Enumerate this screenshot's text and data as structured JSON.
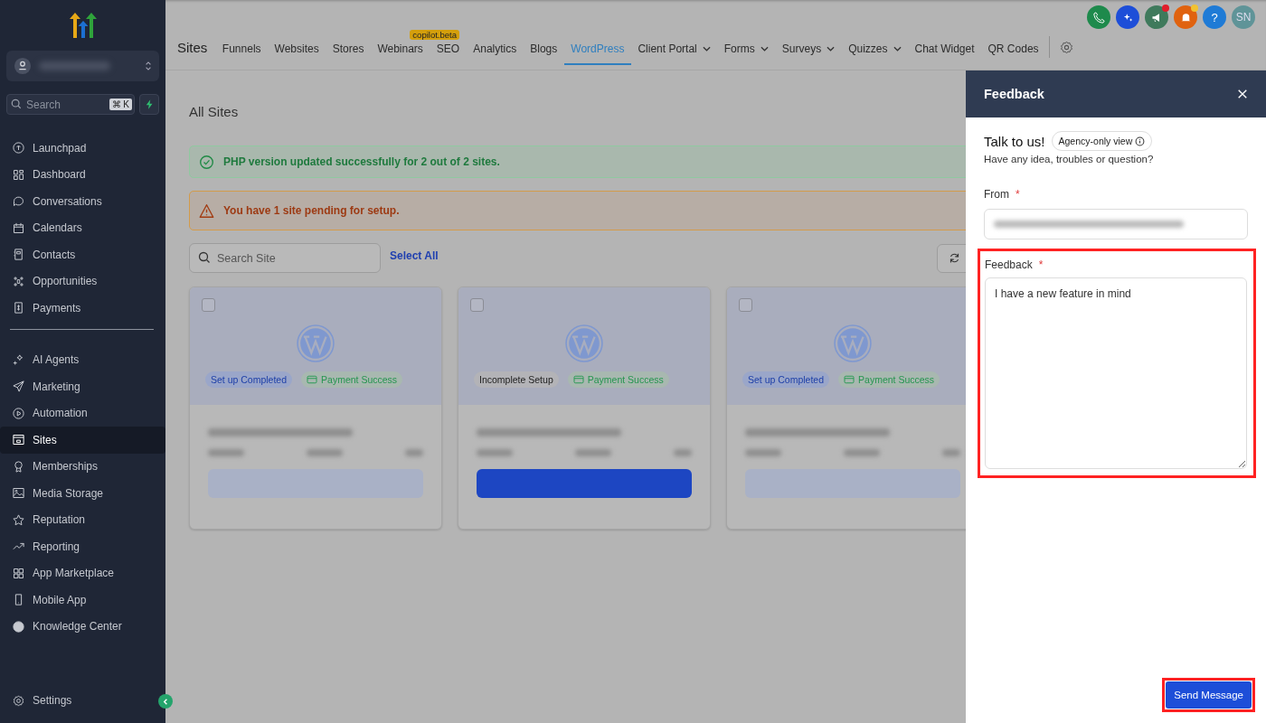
{
  "sidebar": {
    "search": {
      "placeholder": "Search",
      "shortcut": "⌘ K"
    },
    "groups": [
      [
        {
          "label": "Launchpad",
          "selected": false
        },
        {
          "label": "Dashboard",
          "selected": false
        },
        {
          "label": "Conversations",
          "selected": false
        },
        {
          "label": "Calendars",
          "selected": false
        },
        {
          "label": "Contacts",
          "selected": false
        },
        {
          "label": "Opportunities",
          "selected": false
        },
        {
          "label": "Payments",
          "selected": false
        }
      ],
      [
        {
          "label": "AI Agents",
          "selected": false
        },
        {
          "label": "Marketing",
          "selected": false
        },
        {
          "label": "Automation",
          "selected": false
        },
        {
          "label": "Sites",
          "selected": true
        },
        {
          "label": "Memberships",
          "selected": false
        },
        {
          "label": "Media Storage",
          "selected": false
        },
        {
          "label": "Reputation",
          "selected": false
        },
        {
          "label": "Reporting",
          "selected": false
        },
        {
          "label": "App Marketplace",
          "selected": false
        },
        {
          "label": "Mobile App",
          "selected": false
        },
        {
          "label": "Knowledge Center",
          "selected": false
        }
      ]
    ],
    "settings": "Settings"
  },
  "header": {
    "help": "?",
    "avatar": "SN",
    "announcement_unread": true,
    "notifications_unread": true
  },
  "nav": {
    "title": "Sites",
    "tabs": [
      {
        "label": "Funnels",
        "selected": false,
        "dropdown": false
      },
      {
        "label": "Websites",
        "selected": false,
        "dropdown": false
      },
      {
        "label": "Stores",
        "selected": false,
        "dropdown": false
      },
      {
        "label": "Webinars",
        "selected": false,
        "dropdown": false
      },
      {
        "label": "SEO",
        "selected": false,
        "dropdown": false,
        "badge": "copilot.beta"
      },
      {
        "label": "Analytics",
        "selected": false,
        "dropdown": false
      },
      {
        "label": "Blogs",
        "selected": false,
        "dropdown": false
      },
      {
        "label": "WordPress",
        "selected": true,
        "dropdown": false
      },
      {
        "label": "Client Portal",
        "selected": false,
        "dropdown": true
      },
      {
        "label": "Forms",
        "selected": false,
        "dropdown": true
      },
      {
        "label": "Surveys",
        "selected": false,
        "dropdown": true
      },
      {
        "label": "Quizzes",
        "selected": false,
        "dropdown": true
      },
      {
        "label": "Chat Widget",
        "selected": false,
        "dropdown": false
      },
      {
        "label": "QR Codes",
        "selected": false,
        "dropdown": false
      }
    ]
  },
  "page": {
    "title": "All Sites",
    "alerts": [
      {
        "kind": "success",
        "text": "PHP version updated successfully for 2 out of 2 sites."
      },
      {
        "kind": "warning",
        "text": "You have 1 site pending for setup."
      }
    ],
    "search": {
      "placeholder": "Search Site"
    },
    "select_all": "Select All",
    "cards": [
      {
        "checked": false,
        "setup_complete": true,
        "setup_status": "Set up Completed",
        "payment_status": "Payment Success"
      },
      {
        "checked": false,
        "setup_complete": false,
        "setup_status": "Incomplete Setup",
        "payment_status": "Payment Success"
      },
      {
        "checked": false,
        "setup_complete": true,
        "setup_status": "Set up Completed",
        "payment_status": "Payment Success"
      }
    ]
  },
  "feedback": {
    "title": "Feedback",
    "heading": "Talk to us!",
    "badge": "Agency-only view",
    "subtitle": "Have any idea, troubles or question?",
    "from_label": "From",
    "from_required": "*",
    "feedback_label": "Feedback",
    "feedback_required": "*",
    "feedback_value": "I have a new feature in mind",
    "send": "Send Message"
  }
}
